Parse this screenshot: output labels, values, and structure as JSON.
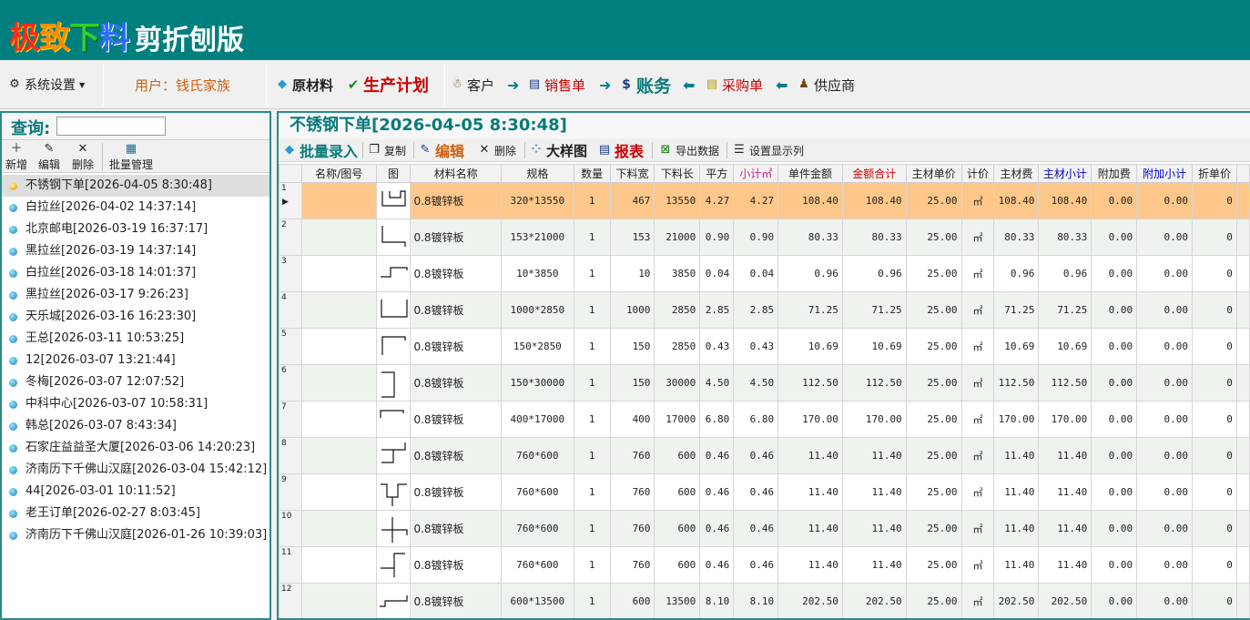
{
  "app": {
    "logo": [
      "极",
      "致",
      "下",
      "料"
    ],
    "title": "剪折刨版"
  },
  "topbar": {
    "settings": "系统设置",
    "user": "用户：钱氏家族",
    "materials": "原材料",
    "production": "生产计划",
    "customer": "客户",
    "sales": "销售单",
    "accounts": "账务",
    "purchase": "采购单",
    "supplier": "供应商"
  },
  "left": {
    "query_label": "查询:",
    "query_value": "",
    "tools": {
      "add": "新增",
      "edit": "编辑",
      "delete": "删除",
      "batch": "批量管理"
    },
    "items": [
      "不锈钢下单[2026-04-05 8:30:48]",
      "白拉丝[2026-04-02 14:37:14]",
      "北京邮电[2026-03-19 16:37:17]",
      "黑拉丝[2026-03-19 14:37:14]",
      "白拉丝[2026-03-18 14:01:37]",
      "黑拉丝[2026-03-17 9:26:23]",
      "天乐城[2026-03-16 16:23:30]",
      "王总[2026-03-11 10:53:25]",
      "12[2026-03-07 13:21:44]",
      "冬梅[2026-03-07 12:07:52]",
      "中科中心[2026-03-07 10:58:31]",
      "韩总[2026-03-07 8:43:34]",
      "石家庄益益圣大厦[2026-03-06 14:20:23]",
      "济南历下千佛山汉庭[2026-03-04 15:42:12]",
      "44[2026-03-01 10:11:52]",
      "老王订单[2026-02-27 8:03:45]",
      "济南历下千佛山汉庭[2026-01-26 10:39:03]"
    ]
  },
  "right": {
    "title": "不锈钢下单[2026-04-05 8:30:48]",
    "tools": {
      "batch_entry": "批量录入",
      "copy": "复制",
      "edit": "编辑",
      "delete": "删除",
      "big_drawing": "大样图",
      "report": "报表",
      "export": "导出数据",
      "columns": "设置显示列"
    },
    "columns": [
      "",
      "名称/图号",
      "图",
      "材料名称",
      "规格",
      "数量",
      "下料宽",
      "下料长",
      "平方",
      "小计㎡",
      "单件金额",
      "金额合计",
      "主材单价",
      "计价",
      "主材费",
      "主材小计",
      "附加费",
      "附加小计",
      "折单价"
    ],
    "rows": [
      [
        "1",
        "",
        "A",
        "0.8镀锌板",
        "320*13550",
        "1",
        "467",
        "13550",
        "4.27",
        "4.27",
        "108.40",
        "108.40",
        "25.00",
        "㎡",
        "108.40",
        "108.40",
        "0.00",
        "0.00",
        "0"
      ],
      [
        "2",
        "",
        "B",
        "0.8镀锌板",
        "153*21000",
        "1",
        "153",
        "21000",
        "0.90",
        "0.90",
        "80.33",
        "80.33",
        "25.00",
        "㎡",
        "80.33",
        "80.33",
        "0.00",
        "0.00",
        "0"
      ],
      [
        "3",
        "",
        "C",
        "0.8镀锌板",
        "10*3850",
        "1",
        "10",
        "3850",
        "0.04",
        "0.04",
        "0.96",
        "0.96",
        "25.00",
        "㎡",
        "0.96",
        "0.96",
        "0.00",
        "0.00",
        "0"
      ],
      [
        "4",
        "",
        "D",
        "0.8镀锌板",
        "1000*2850",
        "1",
        "1000",
        "2850",
        "2.85",
        "2.85",
        "71.25",
        "71.25",
        "25.00",
        "㎡",
        "71.25",
        "71.25",
        "0.00",
        "0.00",
        "0"
      ],
      [
        "5",
        "",
        "E",
        "0.8镀锌板",
        "150*2850",
        "1",
        "150",
        "2850",
        "0.43",
        "0.43",
        "10.69",
        "10.69",
        "25.00",
        "㎡",
        "10.69",
        "10.69",
        "0.00",
        "0.00",
        "0"
      ],
      [
        "6",
        "",
        "F",
        "0.8镀锌板",
        "150*30000",
        "1",
        "150",
        "30000",
        "4.50",
        "4.50",
        "112.50",
        "112.50",
        "25.00",
        "㎡",
        "112.50",
        "112.50",
        "0.00",
        "0.00",
        "0"
      ],
      [
        "7",
        "",
        "G",
        "0.8镀锌板",
        "400*17000",
        "1",
        "400",
        "17000",
        "6.80",
        "6.80",
        "170.00",
        "170.00",
        "25.00",
        "㎡",
        "170.00",
        "170.00",
        "0.00",
        "0.00",
        "0"
      ],
      [
        "8",
        "",
        "H",
        "0.8镀锌板",
        "760*600",
        "1",
        "760",
        "600",
        "0.46",
        "0.46",
        "11.40",
        "11.40",
        "25.00",
        "㎡",
        "11.40",
        "11.40",
        "0.00",
        "0.00",
        "0"
      ],
      [
        "9",
        "",
        "I",
        "0.8镀锌板",
        "760*600",
        "1",
        "760",
        "600",
        "0.46",
        "0.46",
        "11.40",
        "11.40",
        "25.00",
        "㎡",
        "11.40",
        "11.40",
        "0.00",
        "0.00",
        "0"
      ],
      [
        "10",
        "",
        "J",
        "0.8镀锌板",
        "760*600",
        "1",
        "760",
        "600",
        "0.46",
        "0.46",
        "11.40",
        "11.40",
        "25.00",
        "㎡",
        "11.40",
        "11.40",
        "0.00",
        "0.00",
        "0"
      ],
      [
        "11",
        "",
        "K",
        "0.8镀锌板",
        "760*600",
        "1",
        "760",
        "600",
        "0.46",
        "0.46",
        "11.40",
        "11.40",
        "25.00",
        "㎡",
        "11.40",
        "11.40",
        "0.00",
        "0.00",
        "0"
      ],
      [
        "12",
        "",
        "L",
        "0.8镀锌板",
        "600*13500",
        "1",
        "600",
        "13500",
        "8.10",
        "8.10",
        "202.50",
        "202.50",
        "25.00",
        "㎡",
        "202.50",
        "202.50",
        "0.00",
        "0.00",
        "0"
      ]
    ],
    "selected_row": 0
  },
  "colors": {
    "header_bg": "#007f7f",
    "accent": "#0a7a7a",
    "selected_row": "#ffc88a",
    "red": "#cc0000"
  }
}
